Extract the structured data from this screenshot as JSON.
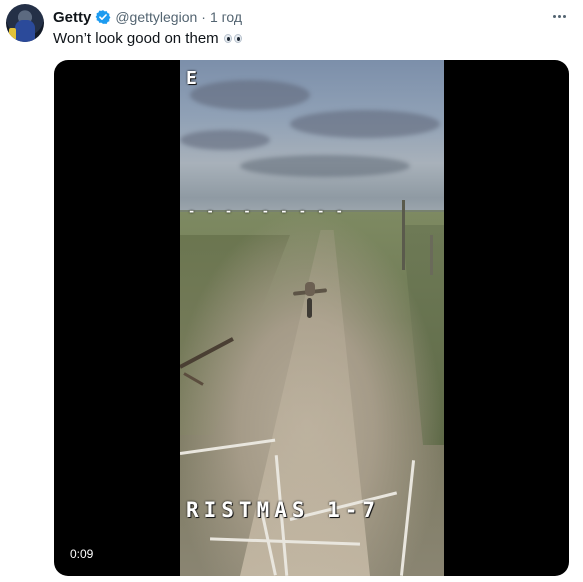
{
  "tweet": {
    "author_name": "Getty",
    "author_handle": "@gettylegion",
    "time_separator": "·",
    "time_ago": "1 год",
    "text": "Won’t look good on them",
    "emoji": "eyes-emoji"
  },
  "media": {
    "type": "video",
    "timestamp": "0:09",
    "osd_top_label": "E",
    "osd_dashes": "- - - - - - - - -",
    "osd_bottom_text": "RISTMAS 1-7"
  },
  "icons": {
    "verified": "verified-badge-icon",
    "more": "more-options-icon"
  },
  "colors": {
    "text_primary": "#0f1419",
    "text_secondary": "#536471",
    "verified_blue": "#1d9bf0",
    "media_bg": "#000000"
  }
}
